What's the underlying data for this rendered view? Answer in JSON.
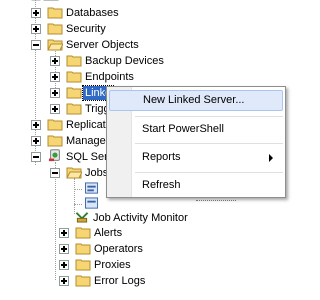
{
  "tree": {
    "items": [
      {
        "label": "Databases",
        "icon": "folder-icon",
        "expander": "plus"
      },
      {
        "label": "Security",
        "icon": "folder-icon",
        "expander": "plus"
      },
      {
        "label": "Server Objects",
        "icon": "folder-icon",
        "expander": "minus"
      },
      {
        "label": "Backup Devices",
        "icon": "folder-icon",
        "expander": "plus"
      },
      {
        "label": "Endpoints",
        "icon": "folder-icon",
        "expander": "plus"
      },
      {
        "label": "Linke",
        "icon": "folder-icon",
        "expander": "plus",
        "selected": true
      },
      {
        "label": "Trigg",
        "icon": "folder-icon",
        "expander": "plus"
      },
      {
        "label": "Replicati",
        "icon": "folder-icon",
        "expander": "plus"
      },
      {
        "label": "Managem",
        "icon": "folder-icon",
        "expander": "plus"
      },
      {
        "label": "SQL Serv",
        "icon": "sql-agent-icon",
        "expander": "minus"
      },
      {
        "label": "Jobs",
        "icon": "folder-icon",
        "expander": "minus"
      },
      {
        "label": "",
        "icon": "job-icon"
      },
      {
        "label": "",
        "icon": "job-icon"
      },
      {
        "label": "Job Activity Monitor",
        "icon": "job-activity-monitor-icon"
      },
      {
        "label": "Alerts",
        "icon": "folder-icon",
        "expander": "plus"
      },
      {
        "label": "Operators",
        "icon": "folder-icon",
        "expander": "plus"
      },
      {
        "label": "Proxies",
        "icon": "folder-icon",
        "expander": "plus"
      },
      {
        "label": "Error Logs",
        "icon": "folder-icon",
        "expander": "plus"
      }
    ]
  },
  "context_menu": {
    "items": [
      {
        "label": "New Linked Server...",
        "active": true
      },
      {
        "label": "Start PowerShell"
      },
      {
        "label": "Reports",
        "submenu": true,
        "icon": "submenu-arrow-icon"
      },
      {
        "label": "Refresh"
      }
    ]
  },
  "colors": {
    "folder_fill": "#f6d574",
    "folder_edge": "#b58d2a",
    "selection": "#316ac5",
    "menu_highlight": "#dfe9f9",
    "menu_highlight_border": "#aac5ef"
  }
}
